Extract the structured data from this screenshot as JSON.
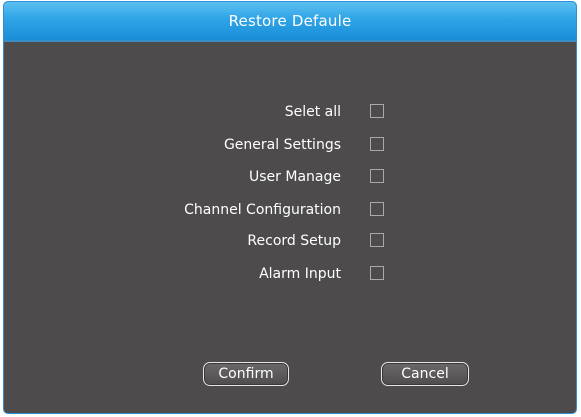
{
  "dialog": {
    "title": "Restore Defaule"
  },
  "options": [
    {
      "label": "Selet all",
      "checked": false
    },
    {
      "label": "General Settings",
      "checked": false
    },
    {
      "label": "User Manage",
      "checked": false
    },
    {
      "label": "Channel Configuration",
      "checked": false
    },
    {
      "label": "Record Setup",
      "checked": false
    },
    {
      "label": "Alarm Input",
      "checked": false
    }
  ],
  "buttons": {
    "confirm_label": "Confirm",
    "cancel_label": "Cancel"
  },
  "colors": {
    "titlebar": "#2ea3e6",
    "background": "#4d4b4c",
    "text": "#ffffff"
  }
}
